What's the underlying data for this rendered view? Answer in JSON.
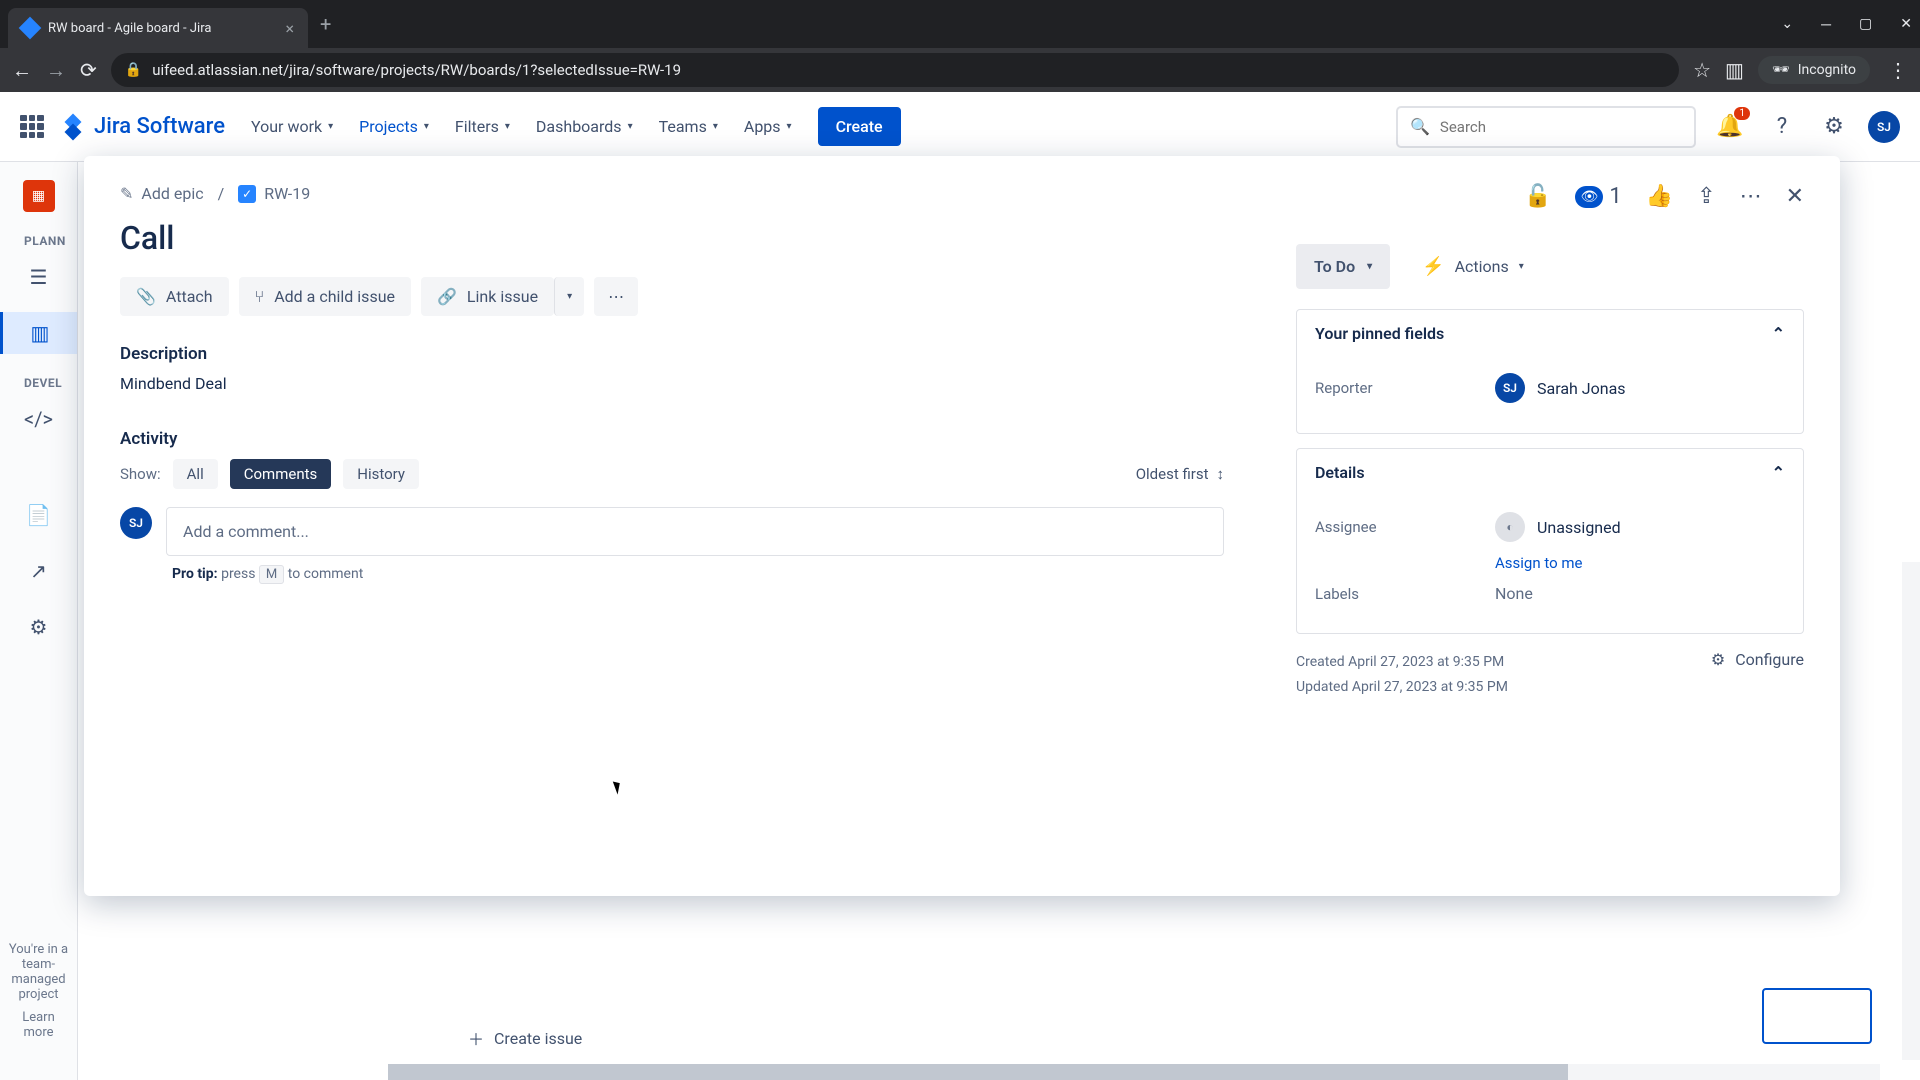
{
  "browser": {
    "tab_title": "RW board - Agile board - Jira",
    "url": "uifeed.atlassian.net/jira/software/projects/RW/boards/1?selectedIssue=RW-19",
    "incognito": "Incognito"
  },
  "topnav": {
    "logo": "Jira Software",
    "items": [
      "Your work",
      "Projects",
      "Filters",
      "Dashboards",
      "Teams",
      "Apps"
    ],
    "active_index": 1,
    "create": "Create",
    "search_placeholder": "Search",
    "notification_count": "1",
    "user_initials": "SJ"
  },
  "sidebar": {
    "section1": "PLANN",
    "section2": "DEVEL",
    "footer1": "You're in a team-managed project",
    "footer2": "Learn more"
  },
  "board": {
    "create_issue": "Create issue"
  },
  "issue": {
    "breadcrumb": {
      "add_epic": "Add epic",
      "sep": "/",
      "key": "RW-19"
    },
    "title": "Call",
    "actions": {
      "attach": "Attach",
      "add_child": "Add a child issue",
      "link": "Link issue"
    },
    "description_h": "Description",
    "description": "Mindbend Deal",
    "activity_h": "Activity",
    "show_label": "Show:",
    "tabs": [
      "All",
      "Comments",
      "History"
    ],
    "active_tab": 1,
    "sort": "Oldest first",
    "comment_placeholder": "Add a comment...",
    "protip_label": "Pro tip:",
    "protip_press": "press",
    "protip_key": "M",
    "protip_rest": "to comment",
    "watch_count": "1",
    "status": "To Do",
    "actions_dd": "Actions",
    "pinned_h": "Your pinned fields",
    "reporter_label": "Reporter",
    "reporter_name": "Sarah Jonas",
    "details_h": "Details",
    "assignee_label": "Assignee",
    "assignee_val": "Unassigned",
    "assign_link": "Assign to me",
    "labels_label": "Labels",
    "labels_val": "None",
    "created": "Created April 27, 2023 at 9:35 PM",
    "updated": "Updated April 27, 2023 at 9:35 PM",
    "configure": "Configure"
  }
}
